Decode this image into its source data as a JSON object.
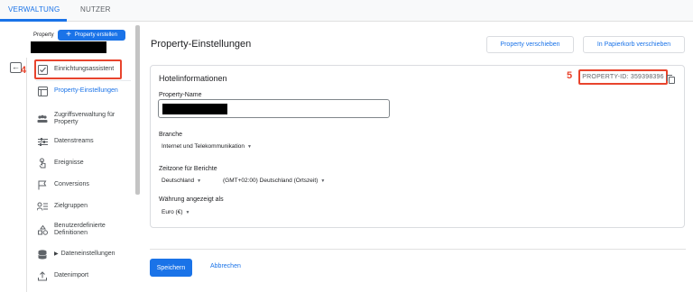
{
  "tabs": [
    {
      "label": "VERWALTUNG",
      "active": true
    },
    {
      "label": "NUTZER",
      "active": false
    }
  ],
  "sidebar": {
    "property_label": "Property",
    "create_button_label": "Property erstellen",
    "step_marker": "4",
    "items": [
      {
        "label": "Einrichtungsassistent",
        "icon": "checklist-icon",
        "active": false
      },
      {
        "label": "Property-Einstellungen",
        "icon": "settings-page-icon",
        "active": true
      },
      {
        "label": "Zugriffsverwaltung für Property",
        "icon": "people-icon",
        "active": false
      },
      {
        "label": "Datenstreams",
        "icon": "streams-icon",
        "active": false
      },
      {
        "label": "Ereignisse",
        "icon": "touch-icon",
        "active": false
      },
      {
        "label": "Conversions",
        "icon": "flag-icon",
        "active": false
      },
      {
        "label": "Zielgruppen",
        "icon": "audience-icon",
        "active": false
      },
      {
        "label": "Benutzerdefinierte Definitionen",
        "icon": "custom-definitions-icon",
        "active": false
      },
      {
        "label": "Dateneinstellungen",
        "icon": "database-icon",
        "active": false
      },
      {
        "label": "Datenimport",
        "icon": "upload-icon",
        "active": false
      }
    ]
  },
  "main": {
    "title": "Property-Einstellungen",
    "move_button": "Property verschieben",
    "trash_button": "In Papierkorb verschieben",
    "card": {
      "title": "Hotelinformationen",
      "step_marker": "5",
      "property_id": "PROPERTY-ID: 359398396",
      "name_label": "Property-Name",
      "industry_label": "Branche",
      "industry_value": "Internet und Telekommunikation",
      "timezone_label": "Zeitzone für Berichte",
      "timezone_country": "Deutschland",
      "timezone_value": "(GMT+02:00) Deutschland (Ortszeit)",
      "currency_label": "Währung angezeigt als",
      "currency_value": "Euro (€)"
    },
    "save_button": "Speichern",
    "cancel_button": "Abbrechen"
  },
  "colors": {
    "accent": "#1a73e8",
    "highlight": "#e8442d"
  }
}
